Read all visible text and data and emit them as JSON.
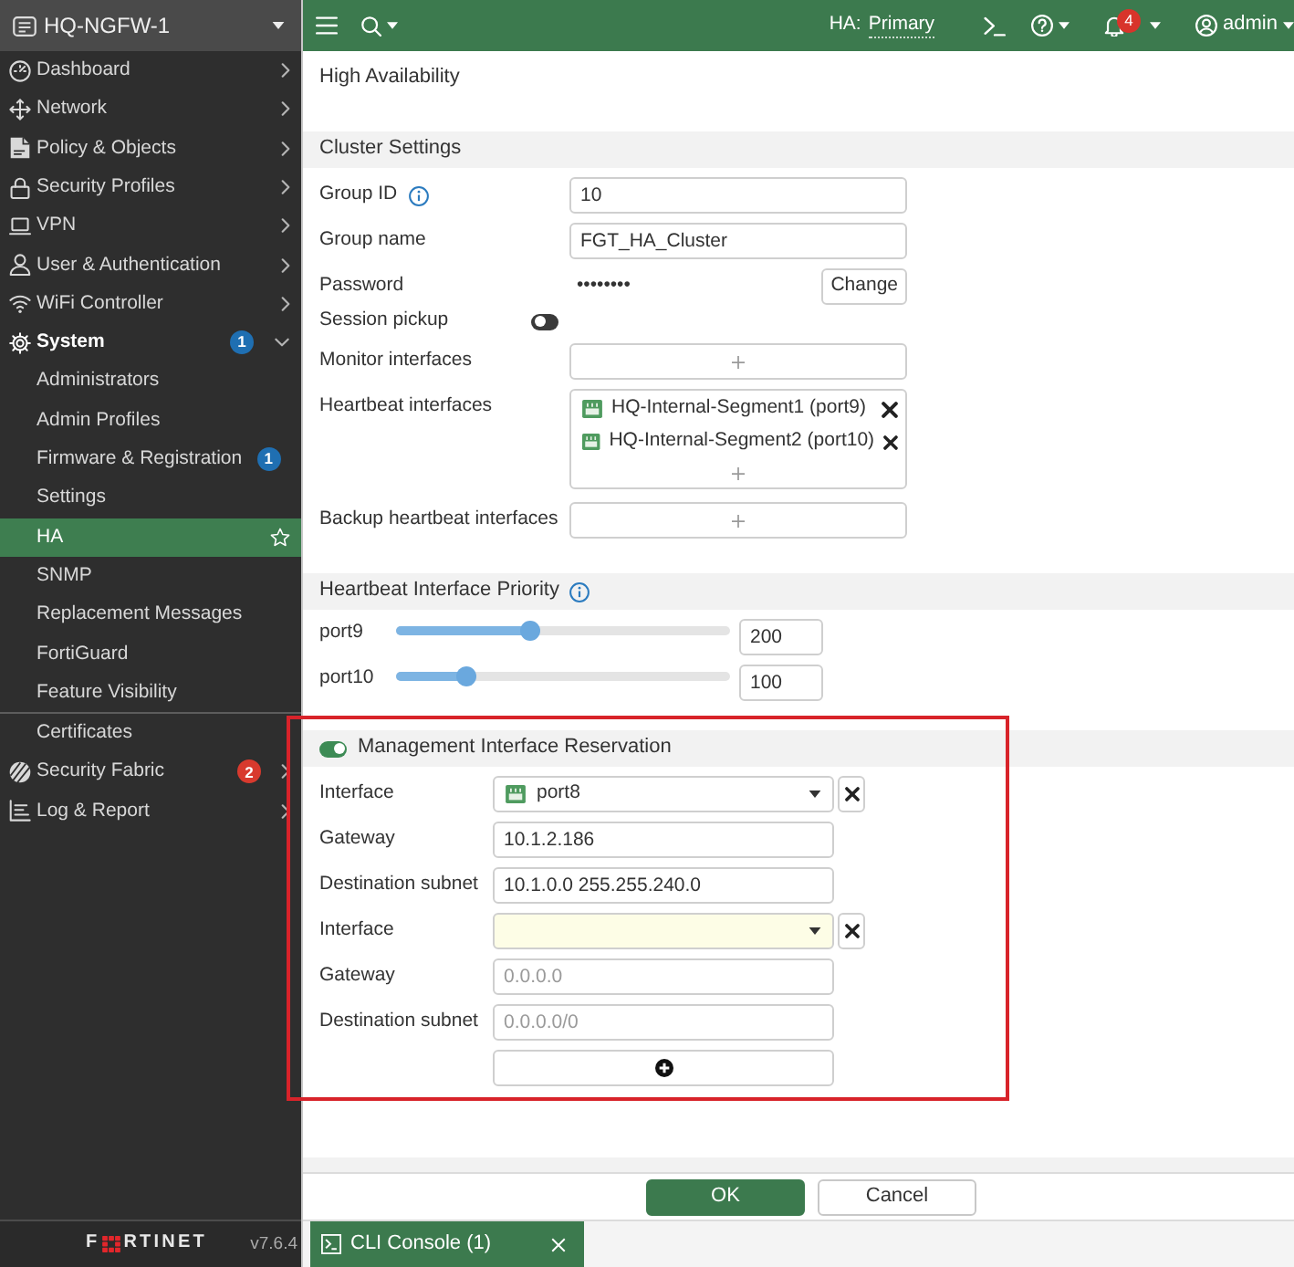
{
  "sidebar": {
    "device": "HQ-NGFW-1",
    "items": [
      {
        "label": "Dashboard",
        "expanded": false,
        "selected": false
      },
      {
        "label": "Network",
        "expanded": false,
        "selected": false
      },
      {
        "label": "Policy & Objects",
        "expanded": false,
        "selected": false
      },
      {
        "label": "Security Profiles",
        "expanded": false,
        "selected": false
      },
      {
        "label": "VPN",
        "expanded": false,
        "selected": false
      },
      {
        "label": "User & Authentication",
        "expanded": false,
        "selected": false
      },
      {
        "label": "WiFi Controller",
        "expanded": false,
        "selected": false
      },
      {
        "label": "System",
        "expanded": true,
        "selected": false,
        "badge": {
          "text": "1",
          "color": "#1f6fb2"
        },
        "children": [
          {
            "kind": "link",
            "label": "Administrators",
            "selected": false
          },
          {
            "kind": "link",
            "label": "Admin Profiles",
            "selected": false
          },
          {
            "kind": "link",
            "label": "Firmware & Registration",
            "selected": false,
            "badge": {
              "text": "1",
              "color": "#1f6fb2"
            }
          },
          {
            "kind": "link",
            "label": "Settings",
            "selected": false
          },
          {
            "kind": "link",
            "label": "HA",
            "selected": true
          },
          {
            "kind": "link",
            "label": "SNMP",
            "selected": false
          },
          {
            "kind": "link",
            "label": "Replacement Messages",
            "selected": false
          },
          {
            "kind": "link",
            "label": "FortiGuard",
            "selected": false
          },
          {
            "kind": "link",
            "label": "Feature Visibility",
            "selected": false
          },
          {
            "kind": "divider"
          },
          {
            "kind": "link",
            "label": "Certificates",
            "selected": false
          }
        ]
      },
      {
        "label": "Security Fabric",
        "expanded": false,
        "selected": false,
        "badge": {
          "text": "2",
          "color": "#d83a2e"
        }
      },
      {
        "label": "Log & Report",
        "expanded": false,
        "selected": false
      }
    ],
    "logo": [
      "F",
      "RTINET"
    ],
    "version": "v7.6.4"
  },
  "top_bar": {
    "ha_label": "HA:",
    "ha_role": "Primary",
    "notifications": "4",
    "user": "admin"
  },
  "title": "High Availability",
  "cluster_settings": {
    "title": "Cluster Settings",
    "fields": [
      {
        "kind": "text",
        "label": "Group ID",
        "info": true,
        "value": "10"
      },
      {
        "kind": "text",
        "label": "Group name",
        "info": false,
        "value": "FGT_HA_Cluster"
      },
      {
        "kind": "password",
        "label": "Password",
        "info": false,
        "value": "••••••••",
        "button": "Change"
      },
      {
        "kind": "toggle",
        "label": "Session pickup",
        "info": false,
        "on": false
      },
      {
        "kind": "list",
        "label": "Monitor interfaces",
        "info": false
      },
      {
        "kind": "list",
        "label": "Heartbeat interfaces",
        "info": false,
        "entries": [
          "HQ-Internal-Segment1 (port9)",
          "HQ-Internal-Segment2 (port10)"
        ]
      },
      {
        "kind": "list",
        "label": "Backup heartbeat interfaces",
        "info": false
      }
    ]
  },
  "heartbeat_priority": {
    "title": "Heartbeat Interface Priority",
    "info": true,
    "rows": [
      {
        "label": "port9",
        "level": 0.4,
        "value": "200"
      },
      {
        "label": "port10",
        "level": 0.21,
        "value": "100"
      }
    ]
  },
  "management_reservation": {
    "title": "Management Interface Reservation",
    "on": true,
    "highlighted": true,
    "entries": [
      {
        "fields": [
          {
            "kind": "select",
            "label": "Interface",
            "value": "port8",
            "highlighted": false
          },
          {
            "kind": "text",
            "label": "Gateway",
            "value": "10.1.2.186"
          },
          {
            "kind": "text",
            "label": "Destination subnet",
            "value": "10.1.0.0 255.255.240.0"
          }
        ]
      },
      {
        "fields": [
          {
            "kind": "select",
            "label": "Interface",
            "highlighted": true
          },
          {
            "kind": "text",
            "label": "Gateway",
            "placeholder": "0.0.0.0"
          },
          {
            "kind": "text",
            "label": "Destination subnet",
            "placeholder": "0.0.0.0/0"
          }
        ]
      }
    ]
  },
  "buttons": [
    {
      "label": "OK",
      "kind": "primary"
    },
    {
      "label": "Cancel",
      "kind": "secondary"
    }
  ],
  "console_tab": {
    "label": "CLI Console (1)"
  }
}
